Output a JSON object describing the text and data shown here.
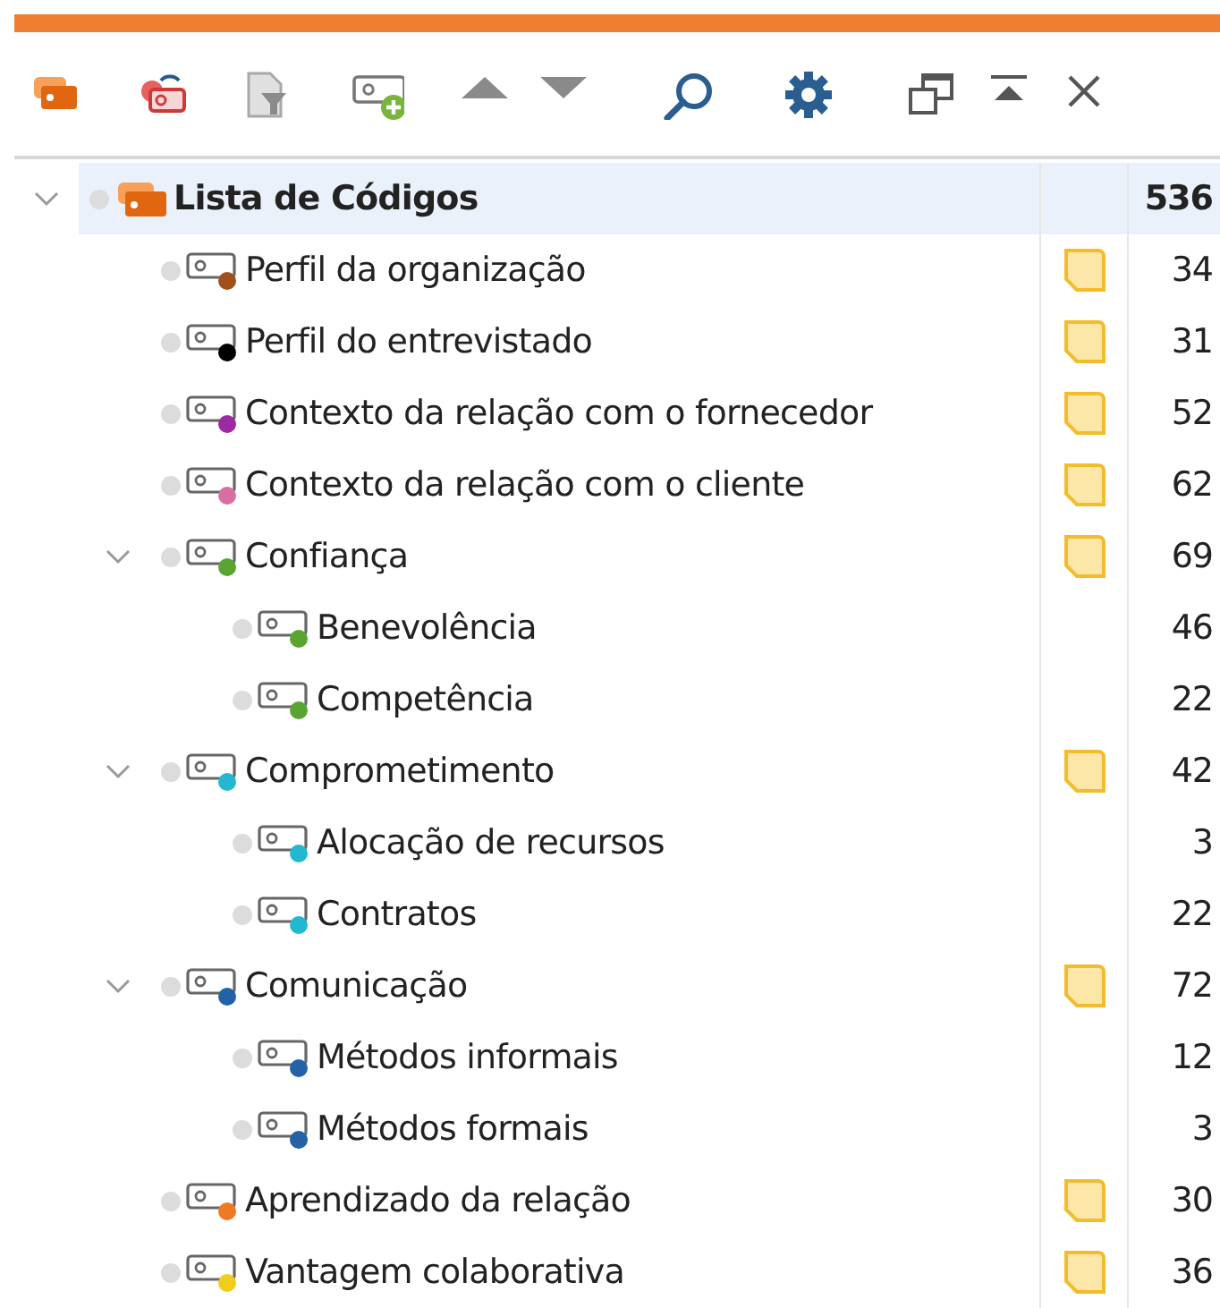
{
  "toolbar": [
    {
      "kind": "codes"
    },
    {
      "kind": "undo-code"
    },
    {
      "kind": "filter"
    },
    {
      "kind": "new-code"
    },
    {
      "kind": "up"
    },
    {
      "kind": "down"
    },
    {
      "kind": "search"
    },
    {
      "kind": "settings"
    },
    {
      "kind": "undock"
    },
    {
      "kind": "collapse"
    },
    {
      "kind": "close"
    }
  ],
  "tree": {
    "label": "Lista de Códigos",
    "count": "536",
    "selected": true,
    "expanded": true,
    "memo": false,
    "children": [
      {
        "label": "Perfil da organização",
        "color": "#a0501a",
        "count": "34",
        "memo": true,
        "selected": false
      },
      {
        "label": "Perfil do entrevistado",
        "color": "#000000",
        "count": "31",
        "memo": true,
        "selected": false
      },
      {
        "label": "Contexto da relação com o fornecedor",
        "color": "#9c2aa3",
        "count": "52",
        "memo": true,
        "selected": false
      },
      {
        "label": "Contexto da relação com o cliente",
        "color": "#d96fa0",
        "count": "62",
        "memo": true,
        "selected": false
      },
      {
        "label": "Confiança",
        "color": "#5aa532",
        "count": "69",
        "memo": true,
        "selected": false,
        "expanded": true,
        "children": [
          {
            "label": "Benevolência",
            "color": "#5aa532",
            "count": "46",
            "memo": false,
            "selected": false
          },
          {
            "label": "Competência",
            "color": "#5aa532",
            "count": "22",
            "memo": false,
            "selected": false
          }
        ]
      },
      {
        "label": "Comprometimento",
        "color": "#22b8d0",
        "count": "42",
        "memo": true,
        "selected": false,
        "expanded": true,
        "children": [
          {
            "label": "Alocação de recursos",
            "color": "#22b8d0",
            "count": "3",
            "memo": false,
            "selected": false
          },
          {
            "label": "Contratos",
            "color": "#22b8d0",
            "count": "22",
            "memo": false,
            "selected": false
          }
        ]
      },
      {
        "label": "Comunicação",
        "color": "#2462a8",
        "count": "72",
        "memo": true,
        "selected": false,
        "expanded": true,
        "children": [
          {
            "label": "Métodos informais",
            "color": "#2462a8",
            "count": "12",
            "memo": false,
            "selected": false
          },
          {
            "label": "Métodos formais",
            "color": "#2462a8",
            "count": "3",
            "memo": false,
            "selected": false
          }
        ]
      },
      {
        "label": "Aprendizado da relação",
        "color": "#f07a22",
        "count": "30",
        "memo": true,
        "selected": false
      },
      {
        "label": "Vantagem colaborativa",
        "color": "#f2cc1a",
        "count": "36",
        "memo": true,
        "selected": false
      }
    ]
  }
}
